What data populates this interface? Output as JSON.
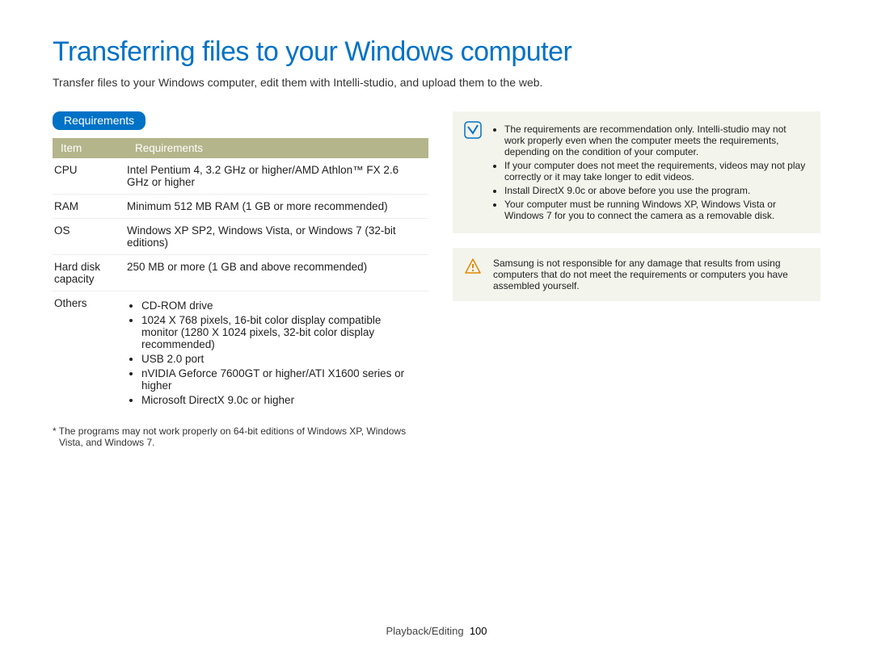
{
  "title": "Transferring files to your Windows computer",
  "subtitle": "Transfer files to your Windows computer, edit them with Intelli-studio, and upload them to the web.",
  "sectionLabel": "Requirements",
  "tableHeader": {
    "item": "Item",
    "req": "Requirements"
  },
  "rows": {
    "cpu": {
      "label": "CPU",
      "value": "Intel Pentium 4, 3.2 GHz or higher/AMD Athlon™ FX 2.6 GHz or higher"
    },
    "ram": {
      "label": "RAM",
      "value": "Minimum 512 MB RAM (1 GB or more recommended)"
    },
    "os": {
      "label": "OS",
      "value": "Windows XP SP2, Windows Vista, or Windows 7 (32-bit editions)"
    },
    "hdd": {
      "label": "Hard disk capacity",
      "value": "250 MB or more (1 GB and above recommended)"
    },
    "others": {
      "label": "Others",
      "items": [
        "CD-ROM drive",
        "1024 X 768 pixels, 16-bit color display compatible monitor (1280 X 1024 pixels, 32-bit color display recommended)",
        "USB 2.0 port",
        "nVIDIA Geforce 7600GT or higher/ATI X1600 series or higher",
        "Microsoft DirectX 9.0c or higher"
      ]
    }
  },
  "footnote": "* The programs may not work properly on 64-bit editions of Windows XP, Windows Vista, and Windows 7.",
  "notes": [
    "The requirements are recommendation only. Intelli-studio may not work properly even when the computer meets the requirements, depending on the condition of your computer.",
    "If your computer does not meet the requirements, videos may not play correctly or it may take longer to edit videos.",
    "Install DirectX 9.0c or above before you use the program.",
    "Your computer must be running Windows XP, Windows Vista or Windows 7 for you to connect the camera as a removable disk."
  ],
  "warning": "Samsung is not responsible for any damage that results from using computers that do not meet the requirements or computers you have assembled yourself.",
  "footer": {
    "section": "Playback/Editing",
    "page": "100"
  }
}
